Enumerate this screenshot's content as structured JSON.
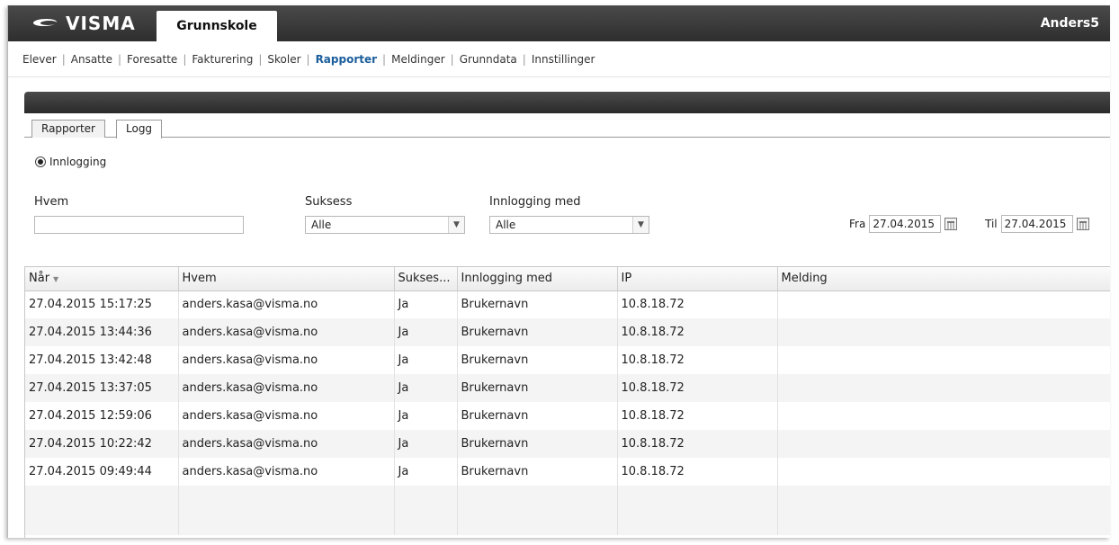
{
  "header": {
    "logo_text": "VISMA",
    "app_tab": "Grunnskole",
    "user": "Anders5"
  },
  "nav": {
    "items": [
      {
        "label": "Elever"
      },
      {
        "label": "Ansatte"
      },
      {
        "label": "Foresatte"
      },
      {
        "label": "Fakturering"
      },
      {
        "label": "Skoler"
      },
      {
        "label": "Rapporter",
        "active": true
      },
      {
        "label": "Meldinger"
      },
      {
        "label": "Grunndata"
      },
      {
        "label": "Innstillinger"
      }
    ]
  },
  "tabs": {
    "rapporter": "Rapporter",
    "logg": "Logg"
  },
  "filter": {
    "radio_label": "Innlogging",
    "hvem_label": "Hvem",
    "hvem_value": "",
    "suksess_label": "Suksess",
    "suksess_value": "Alle",
    "innlogging_med_label": "Innlogging med",
    "innlogging_med_value": "Alle",
    "fra_label": "Fra",
    "fra_value": "27.04.2015",
    "til_label": "Til",
    "til_value": "27.04.2015"
  },
  "table": {
    "columns": [
      "Når",
      "Hvem",
      "Sukses...",
      "Innlogging med",
      "IP",
      "Melding"
    ],
    "rows": [
      [
        "27.04.2015 15:17:25",
        "anders.kasa@visma.no",
        "Ja",
        "Brukernavn",
        "10.8.18.72",
        ""
      ],
      [
        "27.04.2015 13:44:36",
        "anders.kasa@visma.no",
        "Ja",
        "Brukernavn",
        "10.8.18.72",
        ""
      ],
      [
        "27.04.2015 13:42:48",
        "anders.kasa@visma.no",
        "Ja",
        "Brukernavn",
        "10.8.18.72",
        ""
      ],
      [
        "27.04.2015 13:37:05",
        "anders.kasa@visma.no",
        "Ja",
        "Brukernavn",
        "10.8.18.72",
        ""
      ],
      [
        "27.04.2015 12:59:06",
        "anders.kasa@visma.no",
        "Ja",
        "Brukernavn",
        "10.8.18.72",
        ""
      ],
      [
        "27.04.2015 10:22:42",
        "anders.kasa@visma.no",
        "Ja",
        "Brukernavn",
        "10.8.18.72",
        ""
      ],
      [
        "27.04.2015 09:49:44",
        "anders.kasa@visma.no",
        "Ja",
        "Brukernavn",
        "10.8.18.72",
        ""
      ]
    ]
  }
}
